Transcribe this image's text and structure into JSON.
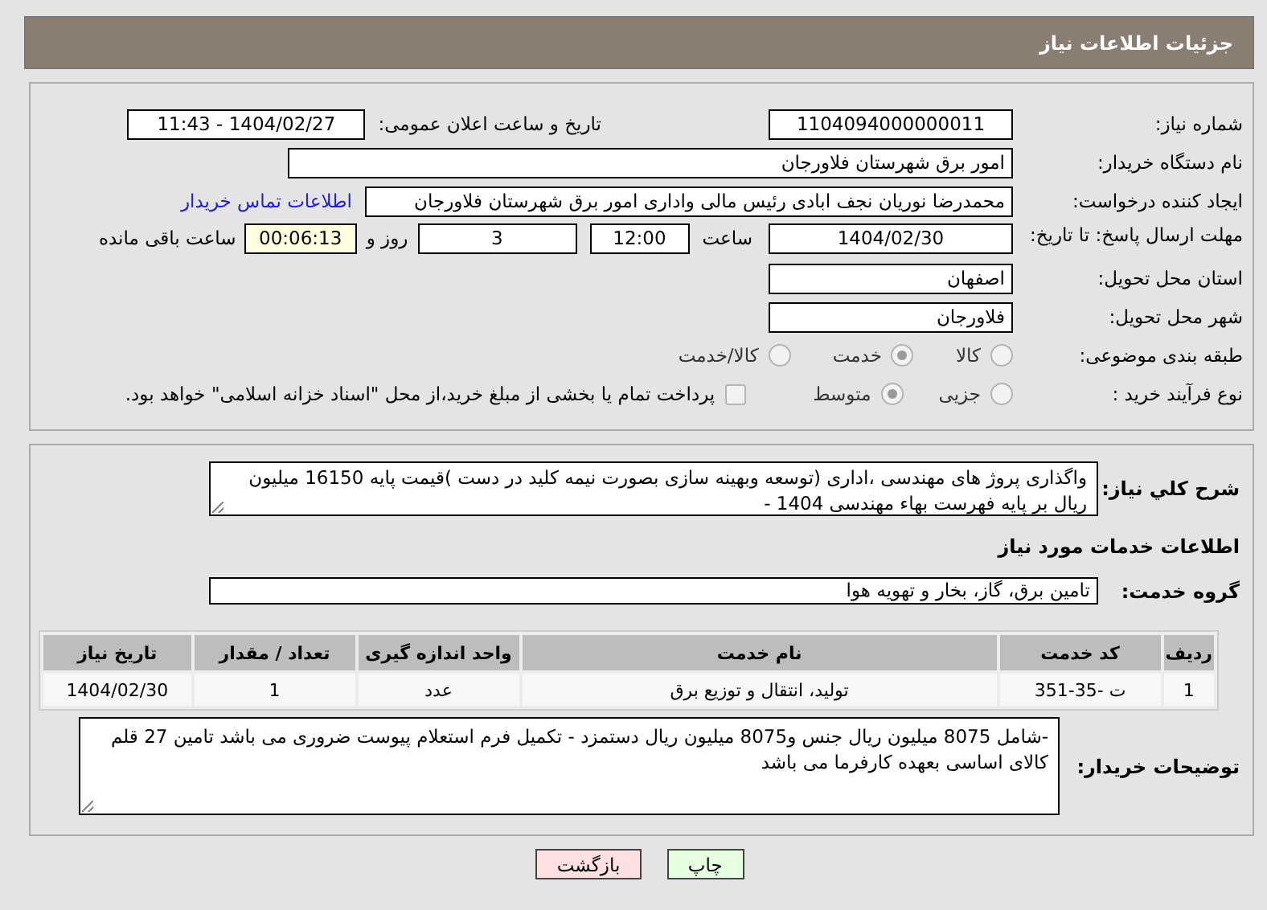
{
  "title": "جزئیات اطلاعات نیاز",
  "need_number": {
    "label": "شماره نیاز:",
    "value": "1104094000000011"
  },
  "announce": {
    "label": "تاریخ و ساعت اعلان عمومی:",
    "value": "1404/02/27 - 11:43"
  },
  "buyer_org": {
    "label": "نام دستگاه خریدار:",
    "value": "امور برق شهرستان فلاورجان"
  },
  "requester": {
    "label": "ایجاد کننده درخواست:",
    "value": "محمدرضا نوریان نجف ابادی رئیس مالی واداری  امور برق شهرستان فلاورجان",
    "link": "اطلاعات تماس خریدار"
  },
  "deadline": {
    "label": "مهلت ارسال پاسخ: تا تاریخ:",
    "date": "1404/02/30",
    "time_label": "ساعت",
    "time": "12:00",
    "days": "3",
    "days_label": "روز و",
    "remaining": "00:06:13",
    "remaining_label": "ساعت باقی مانده"
  },
  "province": {
    "label": "استان محل تحویل:",
    "value": "اصفهان"
  },
  "city": {
    "label": "شهر محل تحویل:",
    "value": "فلاورجان"
  },
  "category": {
    "label": "طبقه بندی موضوعی:",
    "options": [
      {
        "label": "کالا",
        "selected": false
      },
      {
        "label": "خدمت",
        "selected": true
      },
      {
        "label": "کالا/خدمت",
        "selected": false
      }
    ]
  },
  "process": {
    "label": "نوع فرآیند خرید :",
    "options": [
      {
        "label": "جزیی",
        "selected": false
      },
      {
        "label": "متوسط",
        "selected": true
      }
    ],
    "payment": {
      "checked": false,
      "label": "پرداخت تمام یا بخشی از مبلغ خرید،از محل \"اسناد خزانه اسلامی\" خواهد بود."
    }
  },
  "description": {
    "label": "شرح کلي نياز:",
    "value": "واگذاری پروژ های مهندسی ،اداری (توسعه وبهینه سازی بصورت نیمه کلید در دست )قیمت پایه 16150 میلیون ریال بر پایه فهرست بهاء مهندسی 1404 -"
  },
  "services_heading": "اطلاعات خدمات مورد نیاز",
  "service_group": {
    "label": "گروه خدمت:",
    "value": "تامین برق، گاز، بخار و تهویه هوا"
  },
  "table": {
    "columns": [
      "ردیف",
      "کد خدمت",
      "نام خدمت",
      "واحد اندازه گیری",
      "تعداد / مقدار",
      "تاریخ نیاز"
    ],
    "rows": [
      [
        "1",
        "ت -35-351",
        "تولید، انتقال و توزیع برق",
        "عدد",
        "1",
        "1404/02/30"
      ]
    ]
  },
  "buyer_notes": {
    "label": "توضیحات خریدار:",
    "value": "-شامل 8075 میلیون ریال جنس و8075 میلیون ریال دستمزد - تکمیل فرم استعلام پیوست ضروری می باشد تامین 27 قلم کالای اساسی بعهده کارفرما می باشد"
  },
  "buttons": [
    {
      "label": "چاپ",
      "kind": "print"
    },
    {
      "label": "بازگشت",
      "kind": "back"
    }
  ]
}
